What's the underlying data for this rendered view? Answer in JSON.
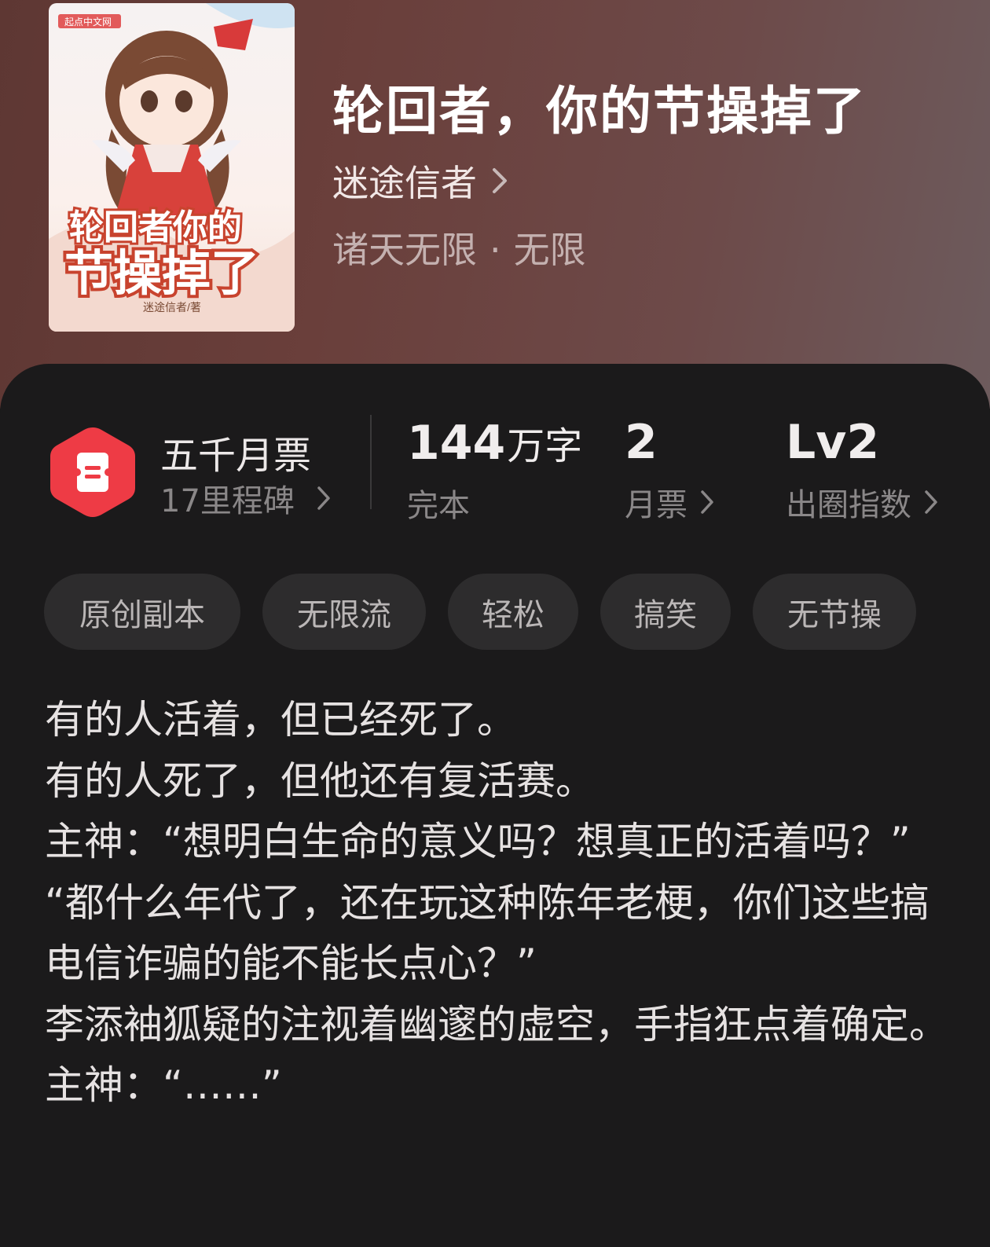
{
  "book": {
    "title": "轮回者，你的节操掉了",
    "author": "迷途信者",
    "genre": "诸天无限",
    "subgenre": "无限",
    "separator": "·"
  },
  "cover": {
    "publisher_mark": "起点中文网",
    "title_line1": "轮回者你的",
    "title_line2": "节操掉了",
    "author_credit": "迷途信者/著"
  },
  "milestone": {
    "title": "五千月票",
    "subtitle": "17里程碑"
  },
  "stats": {
    "words_value": "144",
    "words_unit": "万字",
    "words_label": "完本",
    "votes_value": "2",
    "votes_label": "月票",
    "index_value": "Lv2",
    "index_label": "出圈指数"
  },
  "tags": [
    "原创副本",
    "无限流",
    "轻松",
    "搞笑",
    "无节操"
  ],
  "synopsis": [
    "有的人活着，但已经死了。",
    "有的人死了，但他还有复活赛。",
    "主神：“想明白生命的意义吗？想真正的活着吗？”",
    "“都什么年代了，还在玩这种陈年老梗，你们这些搞电信诈骗的能不能长点心？”",
    "李添袖狐疑的注视着幽邃的虚空，手指狂点着确定。",
    "主神：“……”"
  ],
  "colors": {
    "header_bg": "#6a3f3b",
    "panel_bg": "#1b1a1b",
    "accent_red": "#ee3b45",
    "tag_bg": "#2d2c2d"
  },
  "icons": {
    "author_link": "chevron-right-icon",
    "milestone": "ticket-badge-icon"
  }
}
